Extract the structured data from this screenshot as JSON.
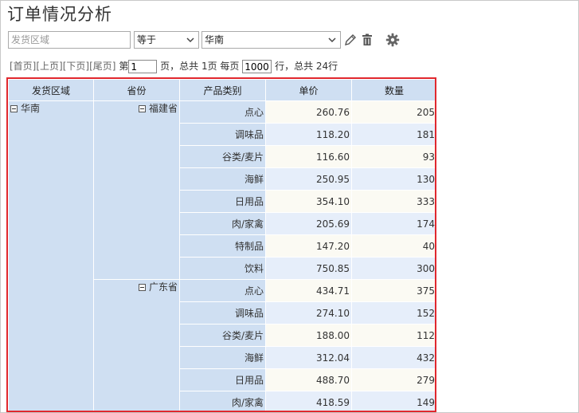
{
  "title": "订单情况分析",
  "filter": {
    "field_placeholder": "发货区域",
    "operator": "等于",
    "value": "华南"
  },
  "icons": {
    "edit": "pencil-icon",
    "delete": "trash-icon",
    "settings": "gear-icon"
  },
  "pager": {
    "first": "[首页]",
    "prev": "[上页]",
    "next": "[下页]",
    "last": "[尾页]",
    "page_prefix": "第",
    "page": "1",
    "page_suffix": "页，总共 1页 每页",
    "per_page": "1000",
    "total_text": "行，总共 24行"
  },
  "table": {
    "headers": [
      "发货区域",
      "省份",
      "产品类别",
      "单价",
      "数量"
    ],
    "region": "华南",
    "provinces": [
      {
        "name": "福建省",
        "rows": [
          {
            "category": "点心",
            "price": "260.76",
            "qty": "205"
          },
          {
            "category": "调味品",
            "price": "118.20",
            "qty": "181"
          },
          {
            "category": "谷类/麦片",
            "price": "116.60",
            "qty": "93"
          },
          {
            "category": "海鲜",
            "price": "250.95",
            "qty": "130"
          },
          {
            "category": "日用品",
            "price": "354.10",
            "qty": "333"
          },
          {
            "category": "肉/家禽",
            "price": "205.69",
            "qty": "174"
          },
          {
            "category": "特制品",
            "price": "147.20",
            "qty": "40"
          },
          {
            "category": "饮料",
            "price": "750.85",
            "qty": "300"
          }
        ]
      },
      {
        "name": "广东省",
        "rows": [
          {
            "category": "点心",
            "price": "434.71",
            "qty": "375"
          },
          {
            "category": "调味品",
            "price": "274.10",
            "qty": "152"
          },
          {
            "category": "谷类/麦片",
            "price": "188.00",
            "qty": "112"
          },
          {
            "category": "海鲜",
            "price": "312.04",
            "qty": "432"
          },
          {
            "category": "日用品",
            "price": "488.70",
            "qty": "279"
          },
          {
            "category": "肉/家禽",
            "price": "418.59",
            "qty": "149"
          }
        ]
      }
    ]
  }
}
